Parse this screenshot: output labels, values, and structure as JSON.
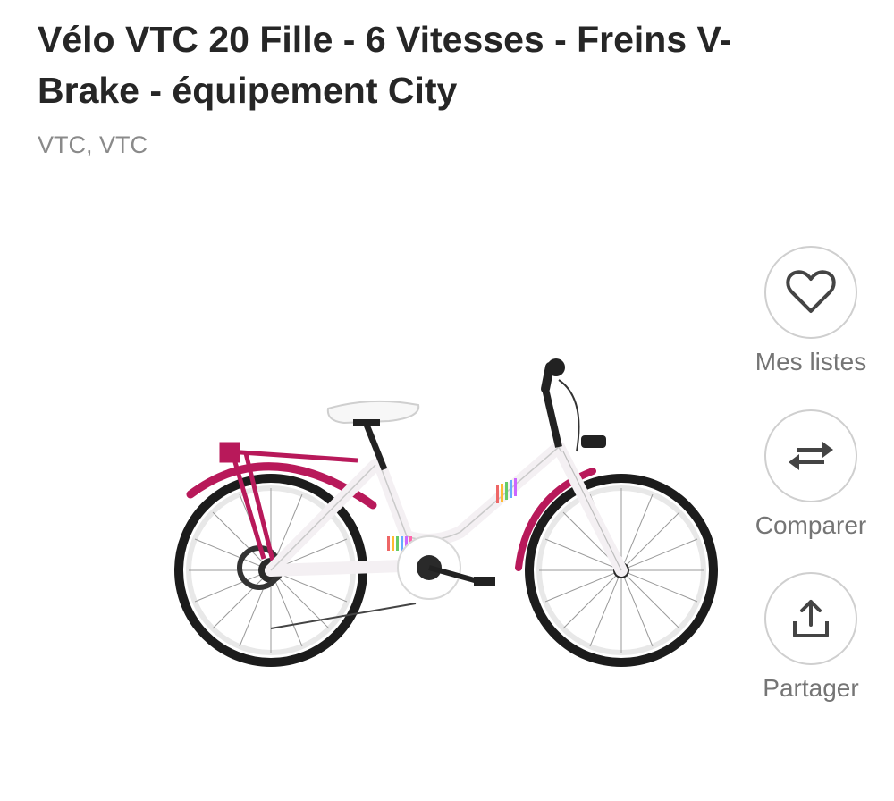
{
  "product": {
    "title": "Vélo VTC 20 Fille - 6 Vitesses - Freins V-Brake - équipement City",
    "category": "VTC, VTC",
    "image_icon": "bicycle-photo",
    "colors": {
      "frame": "#f7f3f6",
      "accent": "#b8195a",
      "tire": "#1a1a1a"
    }
  },
  "actions": {
    "lists": {
      "label": "Mes listes",
      "icon": "heart-icon"
    },
    "compare": {
      "label": "Comparer",
      "icon": "swap-arrows-icon"
    },
    "share": {
      "label": "Partager",
      "icon": "share-upload-icon"
    }
  }
}
